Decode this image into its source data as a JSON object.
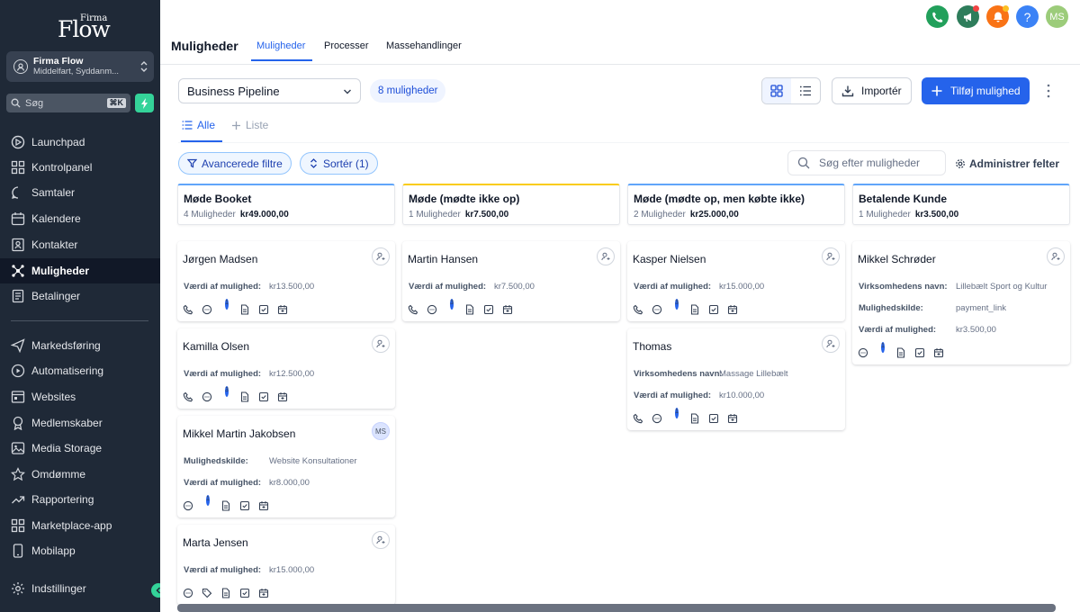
{
  "brand": {
    "logo_word": "Flow",
    "logo_sup": "Firma"
  },
  "account": {
    "name": "Firma Flow",
    "location": "Middelfart, Syddanm..."
  },
  "sidebar": {
    "search_placeholder": "Søg",
    "search_shortcut": "⌘K",
    "items": [
      {
        "label": "Launchpad",
        "icon": "launchpad-icon"
      },
      {
        "label": "Kontrolpanel",
        "icon": "dashboard-icon"
      },
      {
        "label": "Samtaler",
        "icon": "chat-icon"
      },
      {
        "label": "Kalendere",
        "icon": "calendar-icon"
      },
      {
        "label": "Kontakter",
        "icon": "contacts-icon"
      },
      {
        "label": "Muligheder",
        "icon": "opportunities-icon",
        "active": true
      },
      {
        "label": "Betalinger",
        "icon": "payments-icon"
      }
    ],
    "items2": [
      {
        "label": "Markedsføring",
        "icon": "send-icon"
      },
      {
        "label": "Automatisering",
        "icon": "automation-icon"
      },
      {
        "label": "Websites",
        "icon": "websites-icon"
      },
      {
        "label": "Medlemskaber",
        "icon": "membership-icon"
      },
      {
        "label": "Media Storage",
        "icon": "media-icon"
      },
      {
        "label": "Omdømme",
        "icon": "star-icon"
      },
      {
        "label": "Rapportering",
        "icon": "trend-icon"
      },
      {
        "label": "Marketplace-app",
        "icon": "apps-icon"
      },
      {
        "label": "Mobilapp",
        "icon": "mobile-icon"
      }
    ],
    "settings": "Indstillinger"
  },
  "header": {
    "title": "Muligheder",
    "tabs": [
      "Muligheder",
      "Processer",
      "Massehandlinger"
    ],
    "avatar": "MS"
  },
  "toolbar": {
    "pipeline": "Business Pipeline",
    "count": "8 muligheder",
    "import": "Importér",
    "add": "Tilføj mulighed",
    "view_all": "Alle",
    "view_list": "Liste",
    "filters": "Avancerede filtre",
    "sort": "Sortér (1)",
    "search_placeholder": "Søg efter muligheder",
    "manage_fields": "Administrer felter"
  },
  "colors": {
    "accent": "#2563eb",
    "sidebar": "#1f2937",
    "call": "#22a05b",
    "megaphone": "#2e7d5b",
    "bell": "#f97316",
    "help": "#3b82f6",
    "avatar": "#9ccc7a"
  },
  "columns": [
    {
      "name": "Møde Booket",
      "count": "4 Muligheder",
      "total": "kr49.000,00",
      "color": "#60a5fa",
      "cards": [
        {
          "name": "Jørgen Madsen",
          "fields": [
            {
              "label": "Værdi af mulighed:",
              "value": "kr13.500,00"
            }
          ],
          "icons": [
            "phone",
            "chat",
            "tag",
            "doc",
            "check",
            "cal"
          ],
          "badge": "1"
        },
        {
          "name": "Kamilla Olsen",
          "fields": [
            {
              "label": "Værdi af mulighed:",
              "value": "kr12.500,00"
            }
          ],
          "icons": [
            "phone",
            "chat",
            "tag",
            "doc",
            "check",
            "cal"
          ],
          "badge": "3"
        },
        {
          "name": "Mikkel Martin Jakobsen",
          "avatar": "MS",
          "fields": [
            {
              "label": "Mulighedskilde:",
              "value": "Website Konsultationer"
            },
            {
              "label": "Værdi af mulighed:",
              "value": "kr8.000,00"
            }
          ],
          "icons": [
            "chat",
            "tag",
            "doc",
            "check",
            "cal"
          ],
          "badge": "1"
        },
        {
          "name": "Marta Jensen",
          "fields": [
            {
              "label": "Værdi af mulighed:",
              "value": "kr15.000,00"
            }
          ],
          "icons": [
            "chat",
            "tag",
            "doc",
            "check",
            "cal"
          ],
          "badge": ""
        }
      ]
    },
    {
      "name": "Møde (mødte ikke op)",
      "count": "1 Muligheder",
      "total": "kr7.500,00",
      "color": "#facc15",
      "cards": [
        {
          "name": "Martin Hansen",
          "fields": [
            {
              "label": "Værdi af mulighed:",
              "value": "kr7.500,00"
            }
          ],
          "icons": [
            "phone",
            "chat",
            "tag",
            "doc",
            "check",
            "cal"
          ],
          "badge": "3"
        }
      ]
    },
    {
      "name": "Møde (mødte op, men købte ikke)",
      "count": "2 Muligheder",
      "total": "kr25.000,00",
      "color": "#60a5fa",
      "cards": [
        {
          "name": "Kasper Nielsen",
          "fields": [
            {
              "label": "Værdi af mulighed:",
              "value": "kr15.000,00"
            }
          ],
          "icons": [
            "phone",
            "chat",
            "tag",
            "doc",
            "check",
            "cal"
          ],
          "badge": "3"
        },
        {
          "name": "Thomas",
          "fields": [
            {
              "label": "Virksomhedens navn:",
              "value": "Massage Lillebælt"
            },
            {
              "label": "Værdi af mulighed:",
              "value": "kr10.000,00"
            }
          ],
          "icons": [
            "phone",
            "chat",
            "tag",
            "doc",
            "check",
            "cal"
          ],
          "badge": "1"
        }
      ]
    },
    {
      "name": "Betalende Kunde",
      "count": "1 Muligheder",
      "total": "kr3.500,00",
      "color": "#60a5fa",
      "cards": [
        {
          "name": "Mikkel Schrøder",
          "fields": [
            {
              "label": "Virksomhedens navn:",
              "value": "Lillebælt Sport og Kultur"
            },
            {
              "label": "Mulighedskilde:",
              "value": "payment_link"
            },
            {
              "label": "Værdi af mulighed:",
              "value": "kr3.500,00"
            }
          ],
          "icons": [
            "chat",
            "tag",
            "doc",
            "check",
            "cal"
          ],
          "badge": "1"
        }
      ]
    }
  ]
}
